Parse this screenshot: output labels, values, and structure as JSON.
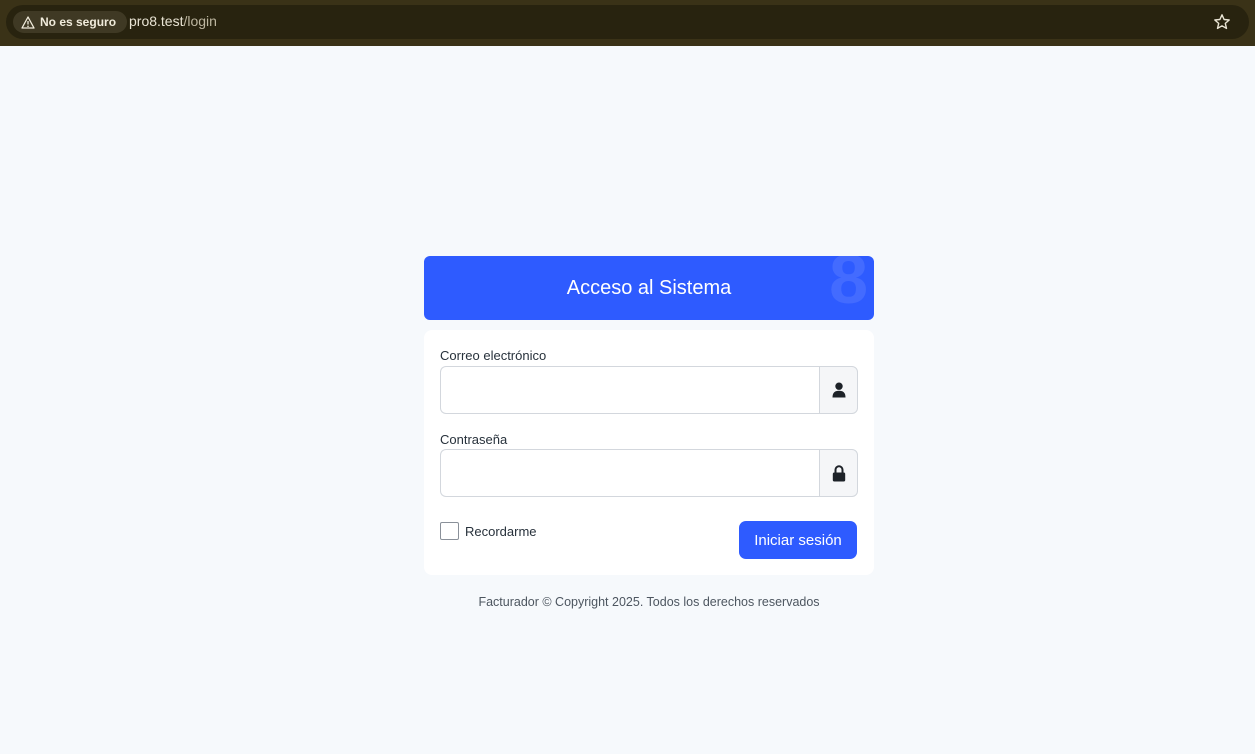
{
  "browser": {
    "security_label": "No es seguro",
    "url_host": "pro8.test",
    "url_path": "/login"
  },
  "login": {
    "title": "Acceso al Sistema",
    "watermark": "8",
    "email_label": "Correo electrónico",
    "email_value": "",
    "password_label": "Contraseña",
    "password_value": "",
    "remember_label": "Recordarme",
    "submit_label": "Iniciar sesión"
  },
  "footer": {
    "text": "Facturador © Copyright 2025. Todos los derechos reservados"
  },
  "colors": {
    "primary": "#2e5bff",
    "page_bg": "#f6f9fc",
    "browser_bar": "#3a3217"
  },
  "icons": {
    "warning": "warning-triangle-icon",
    "bookmark": "star-icon",
    "email_addon": "user-icon",
    "password_addon": "lock-icon"
  }
}
